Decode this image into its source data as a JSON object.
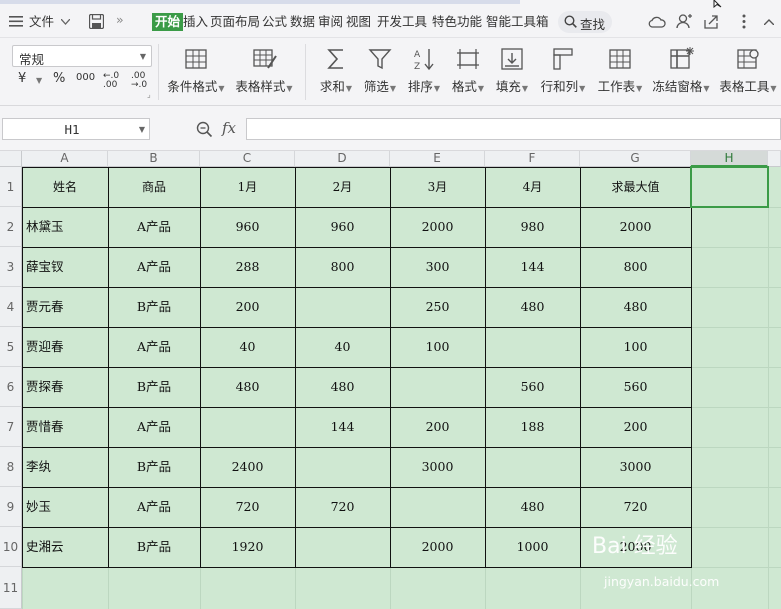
{
  "menubar": {
    "file_label": "文件",
    "more_label": "»",
    "tabs": [
      "开始",
      "插入",
      "页面布局",
      "公式",
      "数据",
      "审阅",
      "视图",
      "开发工具",
      "特色功能",
      "智能工具箱"
    ],
    "active_tab": "开始",
    "search_label": "查找"
  },
  "ribbon": {
    "number_format": "常规",
    "number_buttons": [
      "¥",
      "%",
      "000",
      "←.0 .00",
      ".00 →.0"
    ],
    "groups": [
      {
        "label": "条件格式"
      },
      {
        "label": "表格样式"
      },
      {
        "label": "求和"
      },
      {
        "label": "筛选"
      },
      {
        "label": "排序"
      },
      {
        "label": "格式"
      },
      {
        "label": "填充"
      },
      {
        "label": "行和列"
      },
      {
        "label": "工作表"
      },
      {
        "label": "冻结窗格"
      },
      {
        "label": "表格工具"
      }
    ]
  },
  "formula_bar": {
    "name_box": "H1",
    "fx_label": "fx",
    "formula": ""
  },
  "sheet": {
    "columns": [
      "A",
      "B",
      "C",
      "D",
      "E",
      "F",
      "G",
      "H"
    ],
    "selected_column": "H",
    "rows": [
      "1",
      "2",
      "3",
      "4",
      "5",
      "6",
      "7",
      "8",
      "9",
      "10",
      "11"
    ],
    "header_row": [
      "姓名",
      "商品",
      "1月",
      "2月",
      "3月",
      "4月",
      "求最大值"
    ],
    "data": [
      [
        "林黛玉",
        "A产品",
        "960",
        "960",
        "2000",
        "980",
        "2000"
      ],
      [
        "薛宝钗",
        "A产品",
        "288",
        "800",
        "300",
        "144",
        "800"
      ],
      [
        "贾元春",
        "B产品",
        "200",
        "",
        "250",
        "480",
        "480"
      ],
      [
        "贾迎春",
        "A产品",
        "40",
        "40",
        "100",
        "",
        "100"
      ],
      [
        "贾探春",
        "B产品",
        "480",
        "480",
        "",
        "560",
        "560"
      ],
      [
        "贾惜春",
        "A产品",
        "",
        "144",
        "200",
        "188",
        "200"
      ],
      [
        "李纨",
        "B产品",
        "2400",
        "",
        "3000",
        "",
        "3000"
      ],
      [
        "妙玉",
        "A产品",
        "720",
        "720",
        "",
        "480",
        "720"
      ],
      [
        "史湘云",
        "B产品",
        "1920",
        "",
        "2000",
        "1000",
        "2000"
      ]
    ],
    "selected_cell": "H1"
  },
  "watermark": {
    "text": "Bai 经验",
    "url": "jingyan.baidu.com"
  },
  "colors": {
    "accent": "#3b9b47",
    "sheet_fill": "#cfe8d2"
  }
}
